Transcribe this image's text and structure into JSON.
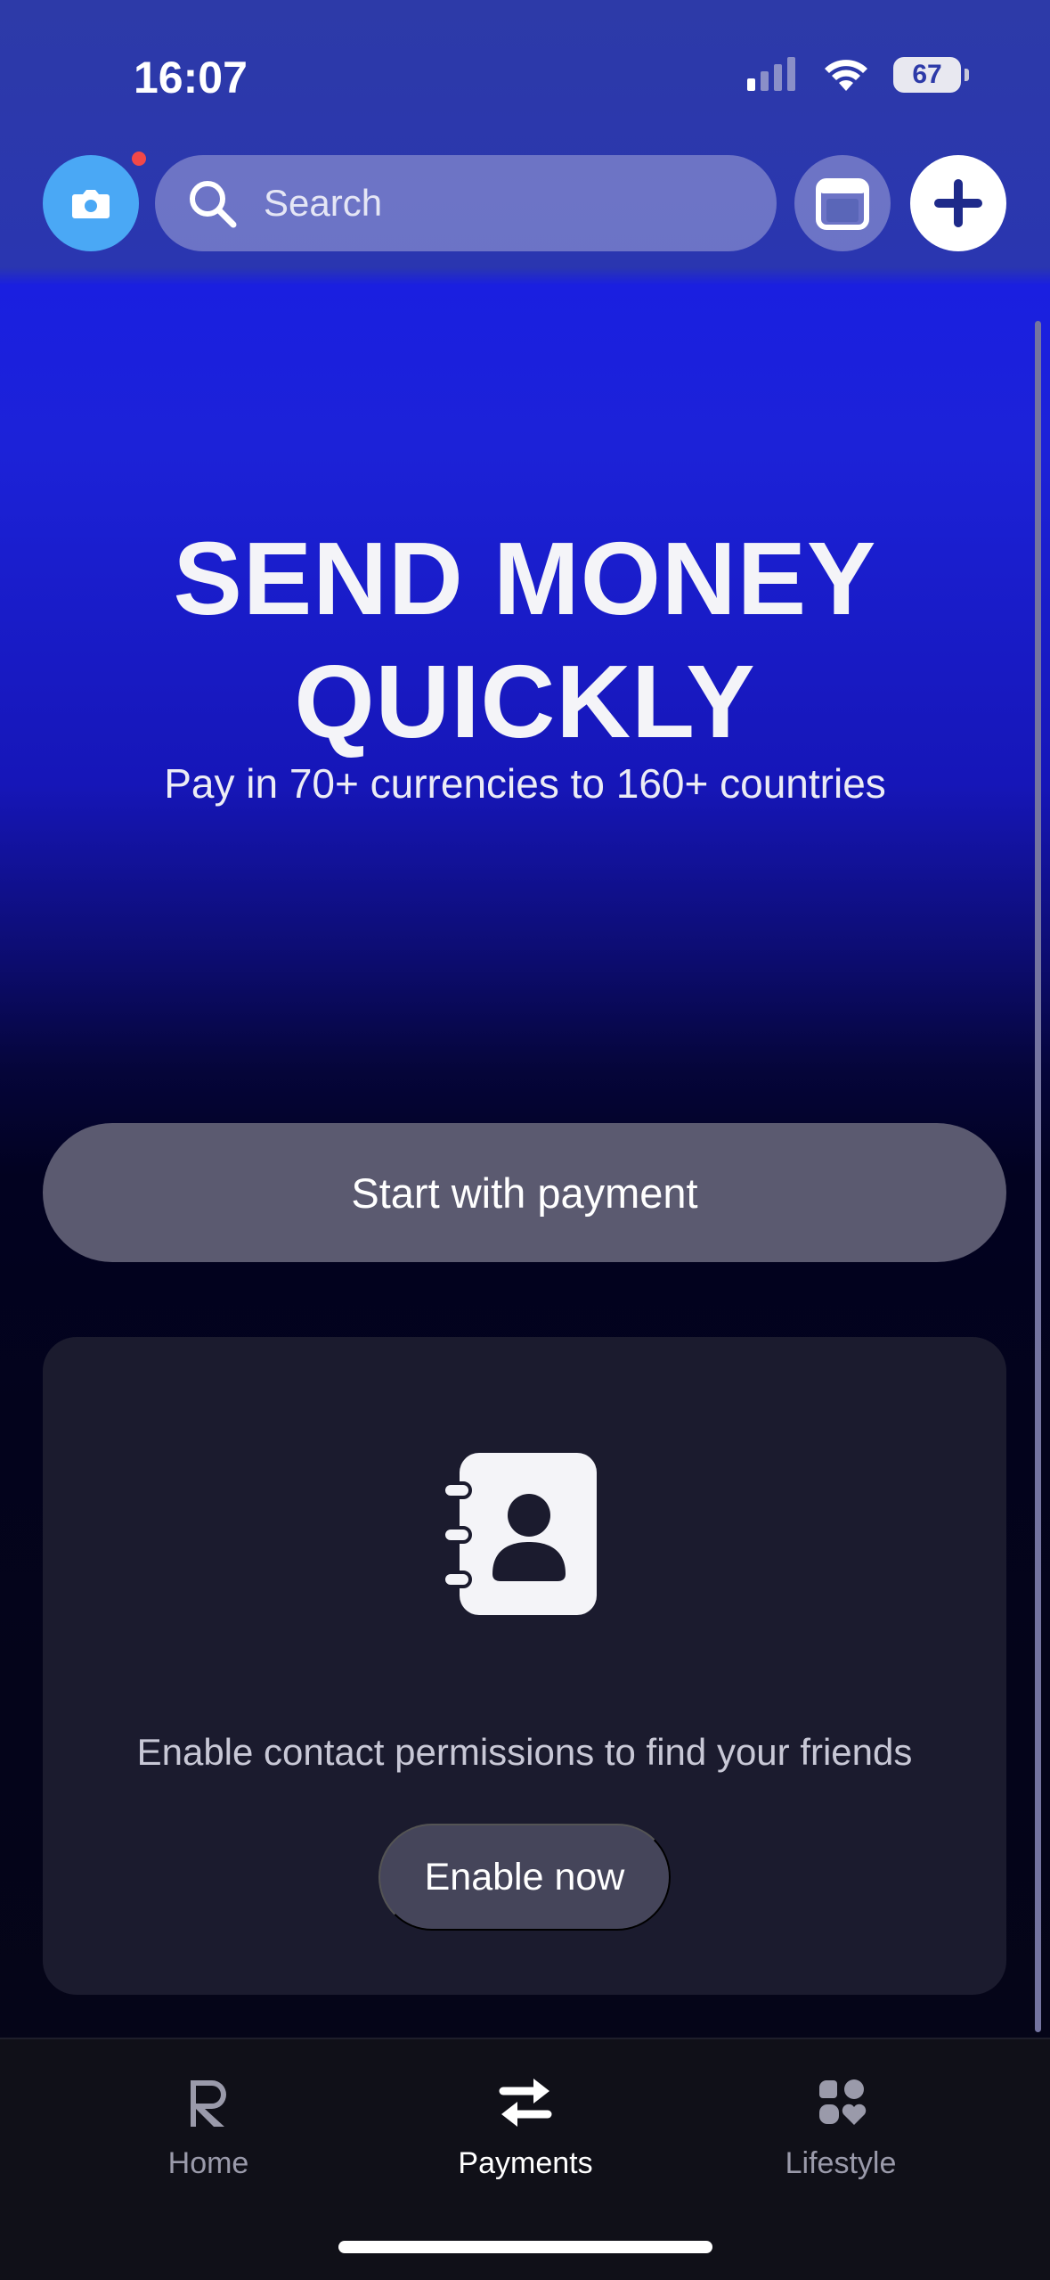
{
  "status_bar": {
    "time": "16:07",
    "battery": "67"
  },
  "header": {
    "search_placeholder": "Search",
    "icons": {
      "camera": "camera-icon",
      "search": "search-icon",
      "calendar": "calendar-icon",
      "add": "plus-icon"
    },
    "notification_dot_color": "#f24848"
  },
  "hero": {
    "title": "SEND MONEY\nQUICKLY",
    "subtitle": "Pay in 70+ currencies to 160+ countries"
  },
  "primary_action": {
    "label": "Start with payment"
  },
  "contacts_card": {
    "icon": "contact-book-icon",
    "message": "Enable contact permissions to find your friends",
    "button_label": "Enable now"
  },
  "bottom_nav": {
    "items": [
      {
        "label": "Home",
        "icon": "revolut-r-icon",
        "active": false
      },
      {
        "label": "Payments",
        "icon": "transfer-arrows-icon",
        "active": true
      },
      {
        "label": "Lifestyle",
        "icon": "lifestyle-icon",
        "active": false
      }
    ]
  },
  "colors": {
    "accent_blue": "#1c22d8",
    "camera_button": "#4aa8f5",
    "background_dark": "#05041a"
  }
}
